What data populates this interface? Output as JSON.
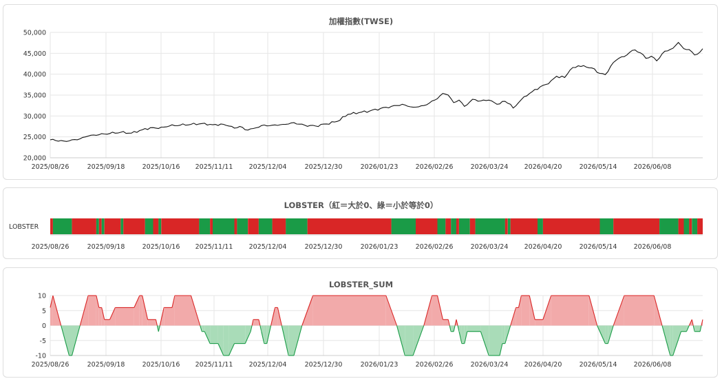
{
  "x_axis_labels": [
    "2025/08/26",
    "2025/09/18",
    "2025/10/16",
    "2025/11/11",
    "2025/12/04",
    "2025/12/30",
    "2026/01/23",
    "2026/02/26",
    "2026/03/24",
    "2026/04/20",
    "2026/05/14",
    "2026/06/08"
  ],
  "colors": {
    "price_line": "#111111",
    "red": "#d92626",
    "green": "#1a9b47",
    "red_fill": "#f2aaaa",
    "green_fill": "#a9dcb8",
    "grid": "#e6e6e6"
  },
  "chart_data": [
    {
      "type": "line",
      "title": "加權指數(TWSE)",
      "ylim": [
        20000,
        50000
      ],
      "y_ticks": [
        20000,
        25000,
        30000,
        35000,
        40000,
        45000,
        50000
      ],
      "y_tick_labels": [
        "20,000",
        "25,000",
        "30,000",
        "35,000",
        "40,000",
        "45,000",
        "50,000"
      ],
      "x_range": [
        0,
        215
      ],
      "anchors": [
        [
          0,
          24300
        ],
        [
          5,
          24000
        ],
        [
          10,
          24300
        ],
        [
          14,
          25200
        ],
        [
          18,
          25500
        ],
        [
          22,
          25800
        ],
        [
          26,
          26100
        ],
        [
          30,
          25900
        ],
        [
          34,
          26700
        ],
        [
          37,
          27200
        ],
        [
          40,
          27000
        ],
        [
          44,
          27600
        ],
        [
          48,
          27800
        ],
        [
          52,
          28000
        ],
        [
          56,
          28200
        ],
        [
          60,
          27900
        ],
        [
          64,
          28000
        ],
        [
          66,
          27600
        ],
        [
          68,
          27100
        ],
        [
          70,
          27500
        ],
        [
          72,
          26700
        ],
        [
          75,
          27000
        ],
        [
          78,
          27700
        ],
        [
          82,
          27800
        ],
        [
          86,
          28000
        ],
        [
          90,
          28400
        ],
        [
          94,
          27800
        ],
        [
          98,
          27600
        ],
        [
          102,
          28100
        ],
        [
          106,
          28700
        ],
        [
          110,
          30400
        ],
        [
          114,
          30800
        ],
        [
          118,
          31200
        ],
        [
          122,
          31800
        ],
        [
          126,
          32300
        ],
        [
          130,
          32800
        ],
        [
          134,
          32100
        ],
        [
          138,
          32500
        ],
        [
          142,
          33800
        ],
        [
          145,
          35400
        ],
        [
          147,
          35000
        ],
        [
          149,
          33200
        ],
        [
          151,
          33800
        ],
        [
          153,
          32300
        ],
        [
          156,
          34000
        ],
        [
          159,
          33600
        ],
        [
          162,
          33800
        ],
        [
          165,
          32800
        ],
        [
          168,
          33500
        ],
        [
          170,
          32800
        ],
        [
          171,
          31900
        ],
        [
          173,
          33200
        ],
        [
          175,
          34600
        ],
        [
          178,
          35800
        ],
        [
          181,
          37000
        ],
        [
          184,
          37700
        ],
        [
          187,
          39500
        ],
        [
          190,
          39200
        ],
        [
          192,
          41000
        ],
        [
          195,
          42000
        ],
        [
          198,
          41700
        ],
        [
          200,
          41500
        ],
        [
          203,
          40200
        ],
        [
          205,
          39900
        ],
        [
          208,
          42800
        ],
        [
          210,
          43800
        ],
        [
          212,
          44200
        ],
        [
          214,
          45200
        ],
        [
          216,
          45800
        ],
        [
          218,
          45100
        ],
        [
          220,
          43800
        ],
        [
          222,
          44300
        ],
        [
          224,
          43200
        ],
        [
          227,
          45500
        ],
        [
          230,
          46200
        ],
        [
          232,
          47600
        ],
        [
          234,
          46100
        ],
        [
          236,
          45900
        ],
        [
          238,
          44600
        ],
        [
          240,
          45300
        ],
        [
          241,
          46100
        ]
      ],
      "x_max": 241
    },
    {
      "type": "heatmap",
      "title": "LOBSTER（紅＝大於0、綠＝小於等於0）",
      "row_label": "LOBSTER",
      "x_max": 241,
      "segments": [
        [
          0,
          1,
          "red"
        ],
        [
          1,
          8,
          "green"
        ],
        [
          8,
          17,
          "red"
        ],
        [
          17,
          18,
          "green"
        ],
        [
          18,
          19,
          "red"
        ],
        [
          19,
          20,
          "green"
        ],
        [
          20,
          26,
          "red"
        ],
        [
          26,
          27,
          "green"
        ],
        [
          27,
          35,
          "red"
        ],
        [
          35,
          38,
          "green"
        ],
        [
          38,
          40,
          "red"
        ],
        [
          40,
          41,
          "green"
        ],
        [
          41,
          55,
          "red"
        ],
        [
          55,
          59,
          "green"
        ],
        [
          59,
          60,
          "red"
        ],
        [
          60,
          68,
          "green"
        ],
        [
          68,
          69,
          "red"
        ],
        [
          69,
          73,
          "green"
        ],
        [
          73,
          77,
          "red"
        ],
        [
          77,
          82,
          "green"
        ],
        [
          82,
          87,
          "red"
        ],
        [
          87,
          95,
          "green"
        ],
        [
          95,
          126,
          "red"
        ],
        [
          126,
          135,
          "green"
        ],
        [
          135,
          143,
          "red"
        ],
        [
          143,
          146,
          "green"
        ],
        [
          146,
          148,
          "red"
        ],
        [
          148,
          150,
          "green"
        ],
        [
          150,
          151,
          "red"
        ],
        [
          151,
          155,
          "green"
        ],
        [
          155,
          157,
          "red"
        ],
        [
          157,
          168,
          "green"
        ],
        [
          168,
          169,
          "red"
        ],
        [
          169,
          170,
          "green"
        ],
        [
          170,
          180,
          "red"
        ],
        [
          180,
          182,
          "green"
        ],
        [
          182,
          203,
          "red"
        ],
        [
          203,
          208,
          "green"
        ],
        [
          208,
          225,
          "red"
        ],
        [
          225,
          232,
          "green"
        ],
        [
          232,
          234,
          "red"
        ],
        [
          234,
          236,
          "green"
        ],
        [
          236,
          237,
          "red"
        ],
        [
          237,
          239,
          "green"
        ],
        [
          239,
          241,
          "red"
        ]
      ]
    },
    {
      "type": "area",
      "title": "LOBSTER_SUM",
      "ylim": [
        -10,
        10
      ],
      "y_ticks": [
        -10,
        -5,
        0,
        5,
        10
      ],
      "y_tick_labels": [
        "-10",
        "-5",
        "0",
        "5",
        "10"
      ],
      "x_max": 241,
      "anchors": [
        [
          0,
          6
        ],
        [
          1,
          10
        ],
        [
          4,
          0
        ],
        [
          7,
          -10
        ],
        [
          8,
          -10
        ],
        [
          11,
          0
        ],
        [
          14,
          10
        ],
        [
          17,
          10
        ],
        [
          18,
          6
        ],
        [
          19,
          6
        ],
        [
          20,
          2
        ],
        [
          22,
          2
        ],
        [
          24,
          6
        ],
        [
          31,
          6
        ],
        [
          33,
          10
        ],
        [
          34,
          10
        ],
        [
          36,
          2
        ],
        [
          39,
          2
        ],
        [
          40,
          -2
        ],
        [
          42,
          6
        ],
        [
          45,
          6
        ],
        [
          46,
          10
        ],
        [
          52,
          10
        ],
        [
          56,
          -2
        ],
        [
          57,
          -2
        ],
        [
          59,
          -6
        ],
        [
          62,
          -6
        ],
        [
          64,
          -10
        ],
        [
          66,
          -10
        ],
        [
          68,
          -6
        ],
        [
          72,
          -6
        ],
        [
          74,
          -2
        ],
        [
          75,
          2
        ],
        [
          77,
          2
        ],
        [
          78,
          -2
        ],
        [
          79,
          -6
        ],
        [
          80,
          -6
        ],
        [
          83,
          6
        ],
        [
          84,
          6
        ],
        [
          88,
          -10
        ],
        [
          90,
          -10
        ],
        [
          93,
          0
        ],
        [
          97,
          10
        ],
        [
          124,
          10
        ],
        [
          128,
          0
        ],
        [
          131,
          -10
        ],
        [
          134,
          -10
        ],
        [
          138,
          0
        ],
        [
          141,
          10
        ],
        [
          143,
          10
        ],
        [
          145,
          2
        ],
        [
          147,
          2
        ],
        [
          148,
          -2
        ],
        [
          149,
          -2
        ],
        [
          150,
          2
        ],
        [
          151,
          -2
        ],
        [
          152,
          -6
        ],
        [
          153,
          -6
        ],
        [
          154,
          -2
        ],
        [
          159,
          -2
        ],
        [
          162,
          -10
        ],
        [
          166,
          -10
        ],
        [
          167,
          -6
        ],
        [
          168,
          -6
        ],
        [
          170,
          0
        ],
        [
          172,
          6
        ],
        [
          173,
          6
        ],
        [
          174,
          10
        ],
        [
          177,
          10
        ],
        [
          179,
          2
        ],
        [
          182,
          2
        ],
        [
          185,
          10
        ],
        [
          199,
          10
        ],
        [
          202,
          0
        ],
        [
          205,
          -6
        ],
        [
          206,
          -6
        ],
        [
          208,
          0
        ],
        [
          212,
          10
        ],
        [
          223,
          10
        ],
        [
          226,
          0
        ],
        [
          229,
          -10
        ],
        [
          230,
          -10
        ],
        [
          233,
          -2
        ],
        [
          235,
          -2
        ],
        [
          237,
          2
        ],
        [
          238,
          -2
        ],
        [
          240,
          -2
        ],
        [
          241,
          2
        ]
      ]
    }
  ]
}
